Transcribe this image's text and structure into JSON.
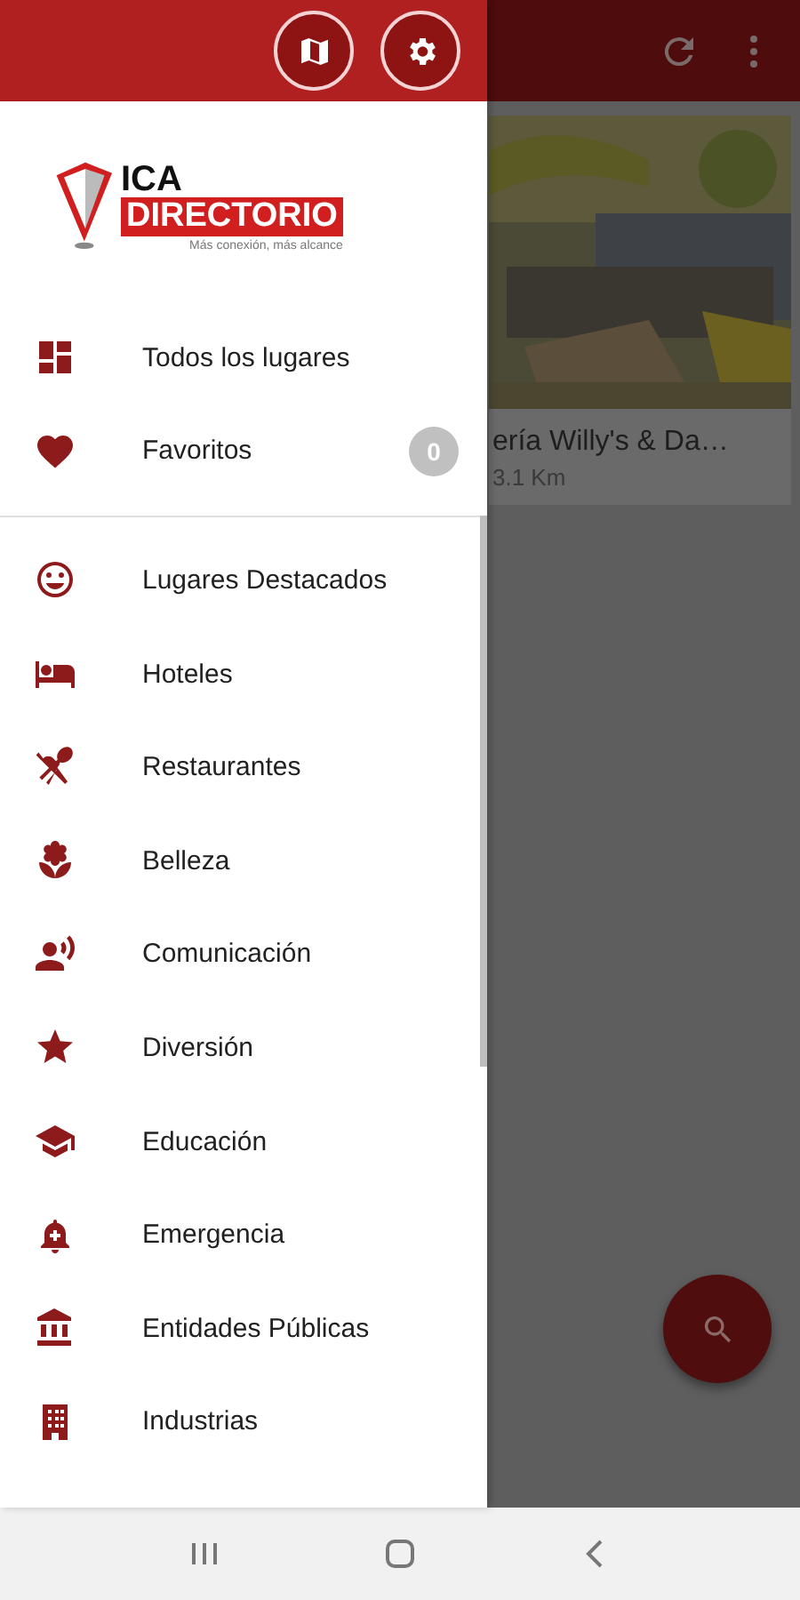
{
  "background_screen": {
    "card": {
      "kind": "picture",
      "title": "ería Willy's & Da…",
      "distance": "3.1 Km"
    }
  },
  "drawer": {
    "logo": {
      "line_1": "ICA",
      "line_2": "DIRECTORIO",
      "tagline": "Más conexión, más alcance"
    },
    "primary_items": [
      {
        "label": "Todos los lugares"
      },
      {
        "label": "Favoritos",
        "badge": "0"
      }
    ],
    "category_items": [
      {
        "label": "Lugares Destacados"
      },
      {
        "label": "Hoteles"
      },
      {
        "label": "Restaurantes"
      },
      {
        "label": "Belleza"
      },
      {
        "label": "Comunicación"
      },
      {
        "label": "Diversión"
      },
      {
        "label": "Educación"
      },
      {
        "label": "Emergencia"
      },
      {
        "label": "Entidades Públicas"
      },
      {
        "label": "Industrias"
      }
    ]
  }
}
